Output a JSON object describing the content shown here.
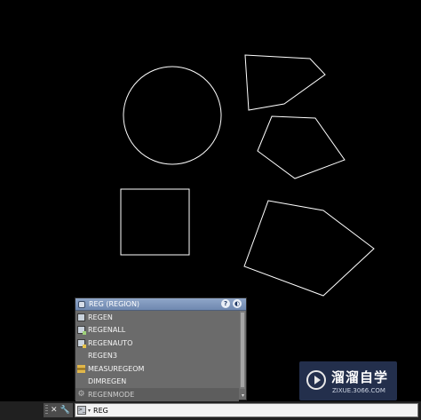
{
  "popup": {
    "title": "REG (REGION)",
    "help_icon": "question-icon",
    "items": [
      {
        "label": "REGEN",
        "icon": "regen-icon"
      },
      {
        "label": "REGENALL",
        "icon": "regenall-icon"
      },
      {
        "label": "REGENAUTO",
        "icon": "regenauto-icon"
      },
      {
        "label": "REGEN3",
        "icon": ""
      },
      {
        "label": "MEASUREGEOM",
        "icon": "measure-icon"
      },
      {
        "label": "DIMREGEN",
        "icon": ""
      },
      {
        "label": "REGENMODE",
        "icon": "gear-icon"
      }
    ]
  },
  "command_line": {
    "input_value": "REG"
  },
  "watermark": {
    "title": "溜溜自学",
    "url": "ZIXUE.3066.COM"
  },
  "colors": {
    "canvas_background": "#000000",
    "shape_stroke": "#ffffff",
    "popup_header": "#7d95bc",
    "popup_body": "#6b6b6b",
    "watermark_bg": "#283656"
  }
}
